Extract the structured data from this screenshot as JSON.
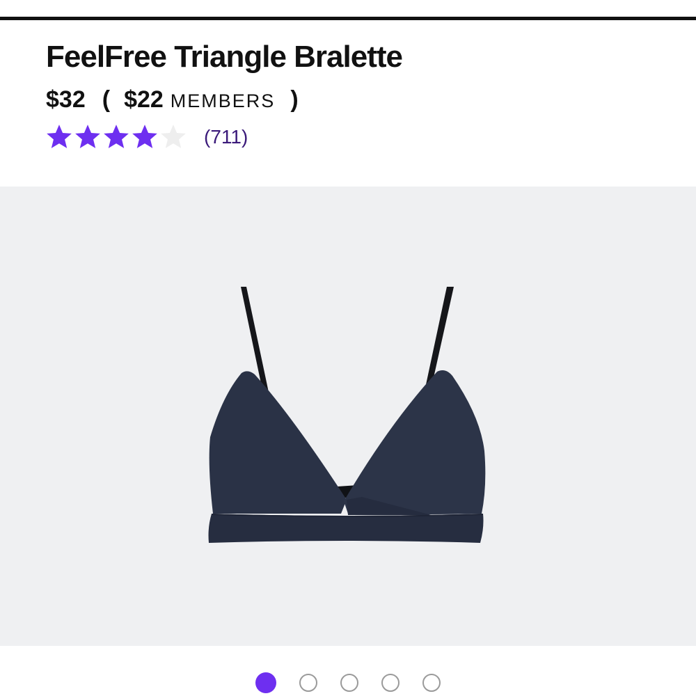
{
  "product": {
    "title": "FeelFree Triangle Bralette",
    "price": "$32",
    "paren_open": "(",
    "member_price": "$22",
    "member_label": "MEMBERS",
    "paren_close": ")",
    "rating": {
      "stars_filled": 4,
      "stars_total": 5,
      "review_count": "(711)"
    }
  },
  "gallery": {
    "image_subject": "navy triangle bralette",
    "slide_count": 5,
    "active_slide": 1
  },
  "colors": {
    "accent": "#6e2ff0",
    "star_filled": "#6e2ff0",
    "star_empty": "#eeeeee",
    "review_count": "#3b1a7a",
    "image_background": "#eff0f2",
    "garment": "#2a3246",
    "strap": "#15161a"
  },
  "icons": {
    "star": "star-icon",
    "carousel_dot": "carousel-dot"
  }
}
